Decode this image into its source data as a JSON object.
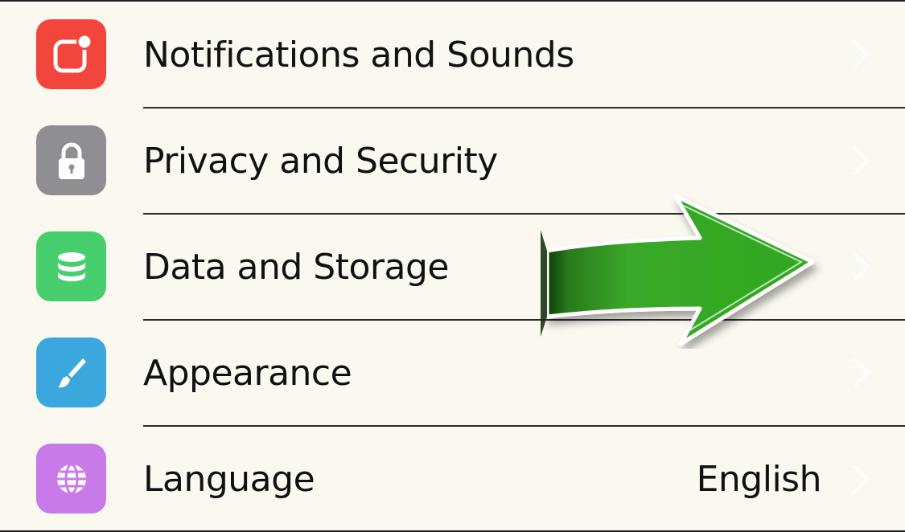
{
  "settings": {
    "items": [
      {
        "label": "Notifications and Sounds",
        "icon": "notification-badge-icon",
        "icon_color": "#f2463d",
        "value": ""
      },
      {
        "label": "Privacy and Security",
        "icon": "lock-icon",
        "icon_color": "#8e8e93",
        "value": ""
      },
      {
        "label": "Data and Storage",
        "icon": "database-icon",
        "icon_color": "#47cf6d",
        "value": ""
      },
      {
        "label": "Appearance",
        "icon": "brush-icon",
        "icon_color": "#3aa8dd",
        "value": ""
      },
      {
        "label": "Language",
        "icon": "globe-icon",
        "icon_color": "#c77ae8",
        "value": "English"
      }
    ]
  },
  "overlay": {
    "arrow": {
      "icon": "green-arrow-annotation-icon",
      "color": "#2fa81e"
    }
  },
  "colors": {
    "background": "#fbf8f0",
    "text": "#111111",
    "chevron": "#ffffff"
  }
}
